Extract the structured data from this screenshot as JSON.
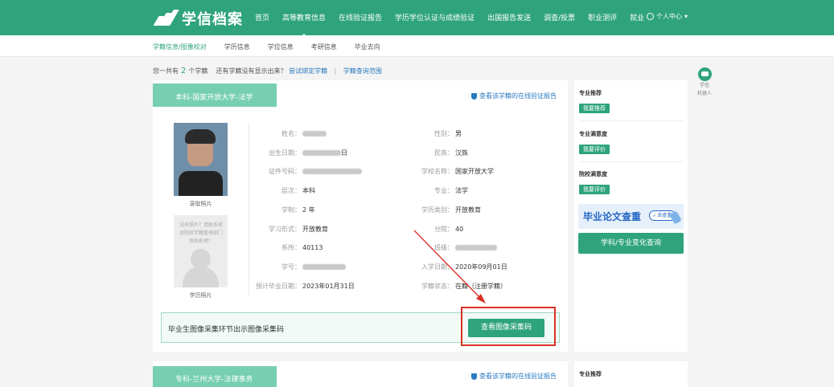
{
  "header": {
    "logo_text": "学信档案",
    "nav": [
      "首页",
      "高等教育信息",
      "在线验证报告",
      "学历学位认证与成绩验证",
      "出国报告发送",
      "调查/投票",
      "职业测评",
      "就业"
    ],
    "active_nav_index": 1,
    "user_center": "个人中心"
  },
  "subnav": {
    "items": [
      "学籍信息/图像校对",
      "学历信息",
      "学位信息",
      "考研信息",
      "毕业去向"
    ],
    "active_index": 0
  },
  "summary": {
    "prefix": "您一共有",
    "count": "2",
    "suffix": "个学籍",
    "question": "还有学籍没有显示出来？",
    "bind_link": "尝试绑定学籍",
    "sep": "|",
    "range_link": "学籍查询范围"
  },
  "card1": {
    "tab_title": "本科-国家开放大学-法学",
    "verify_link": "查看该学籍的在线验证报告",
    "photo1_label": "录取照片",
    "photo2_placeholder": "没有照片？请联系就读院校学籍管理部门协助处理！",
    "photo2_label": "学历照片",
    "left_fields": [
      {
        "label": "姓名：",
        "value": ""
      },
      {
        "label": "出生日期：",
        "value": "日"
      },
      {
        "label": "证件号码：",
        "value": ""
      },
      {
        "label": "层次：",
        "value": "本科"
      },
      {
        "label": "学制：",
        "value": "2 年"
      },
      {
        "label": "学习形式：",
        "value": "开放教育"
      },
      {
        "label": "系所：",
        "value": "40113"
      },
      {
        "label": "学号：",
        "value": ""
      },
      {
        "label": "预计毕业日期：",
        "value": "2023年01月31日"
      }
    ],
    "right_fields": [
      {
        "label": "性别：",
        "value": "男"
      },
      {
        "label": "民族：",
        "value": "汉族"
      },
      {
        "label": "学校名称：",
        "value": "国家开放大学"
      },
      {
        "label": "专业：",
        "value": "法学"
      },
      {
        "label": "学历类别：",
        "value": "开放教育"
      },
      {
        "label": "分院：",
        "value": "40"
      },
      {
        "label": "班级：",
        "value": ""
      },
      {
        "label": "入学日期：",
        "value": "2020年09月01日"
      },
      {
        "label": "学籍状态：",
        "value": "在籍（注册学籍）"
      }
    ],
    "notice_text": "毕业生图像采集环节出示图像采集码",
    "collect_button": "查看图像采集码"
  },
  "right_panel": {
    "major_recommend_title": "专业推荐",
    "major_recommend_btn": "我要推荐",
    "major_satisfaction_title": "专业满意度",
    "major_satisfaction_btn": "我要评价",
    "school_satisfaction_title": "院校满意度",
    "school_satisfaction_btn": "我要评价",
    "banner_text": "毕业论文查重",
    "banner_pill": "去查重",
    "big_button": "学科/专业变化查询"
  },
  "robot": {
    "label1": "学信",
    "label2": "机器人"
  },
  "card2": {
    "tab_title": "专科-兰州大学-法律事务",
    "verify_link": "查看该学籍的在线验证报告",
    "right_title": "专业推荐"
  },
  "colors": {
    "brand": "#2fa47c",
    "link": "#2a7ac0",
    "annotation": "#d93025"
  }
}
